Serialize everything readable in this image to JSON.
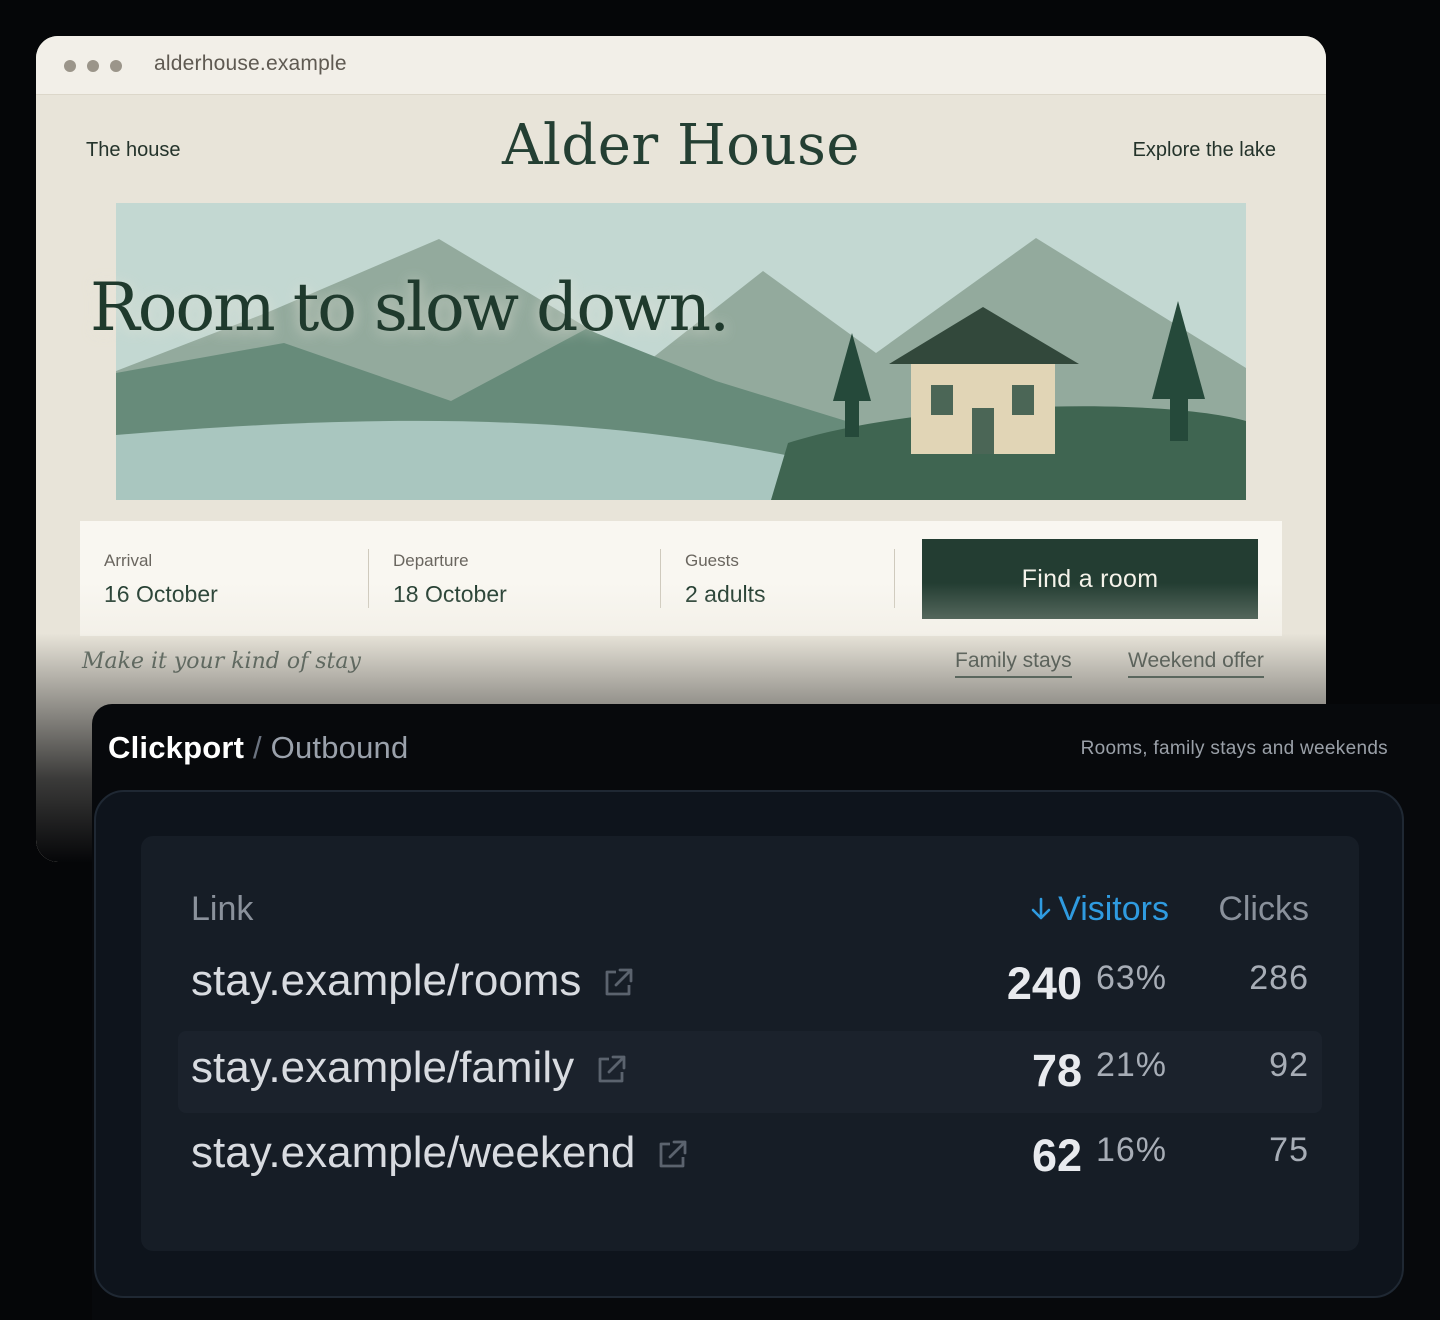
{
  "browser": {
    "url": "alderhouse.example"
  },
  "site": {
    "nav_left": "The house",
    "title": "Alder House",
    "nav_right": "Explore the lake",
    "headline": "Room to slow down.",
    "booking": {
      "arrival_label": "Arrival",
      "arrival_value": "16 October",
      "departure_label": "Departure",
      "departure_value": "18 October",
      "guests_label": "Guests",
      "guests_value": "2 adults",
      "button": "Find a room"
    },
    "tagline": "Make it your kind of stay",
    "promos": [
      "Family stays",
      "Weekend offer"
    ]
  },
  "dashboard": {
    "brand": "Clickport",
    "separator": "/",
    "section": "Outbound",
    "subtitle": "Rooms, family stays and weekends",
    "columns": {
      "link": "Link",
      "visitors": "Visitors",
      "clicks": "Clicks"
    },
    "rows": [
      {
        "link": "stay.example/rooms",
        "visitors": "240",
        "pct": "63%",
        "clicks": "286"
      },
      {
        "link": "stay.example/family",
        "visitors": "78",
        "pct": "21%",
        "clicks": "92"
      },
      {
        "link": "stay.example/weekend",
        "visitors": "62",
        "pct": "16%",
        "clicks": "75"
      }
    ]
  },
  "colors": {
    "brand_green": "#233d32",
    "sort_accent": "#2f9be0",
    "page_bg": "#050608"
  }
}
